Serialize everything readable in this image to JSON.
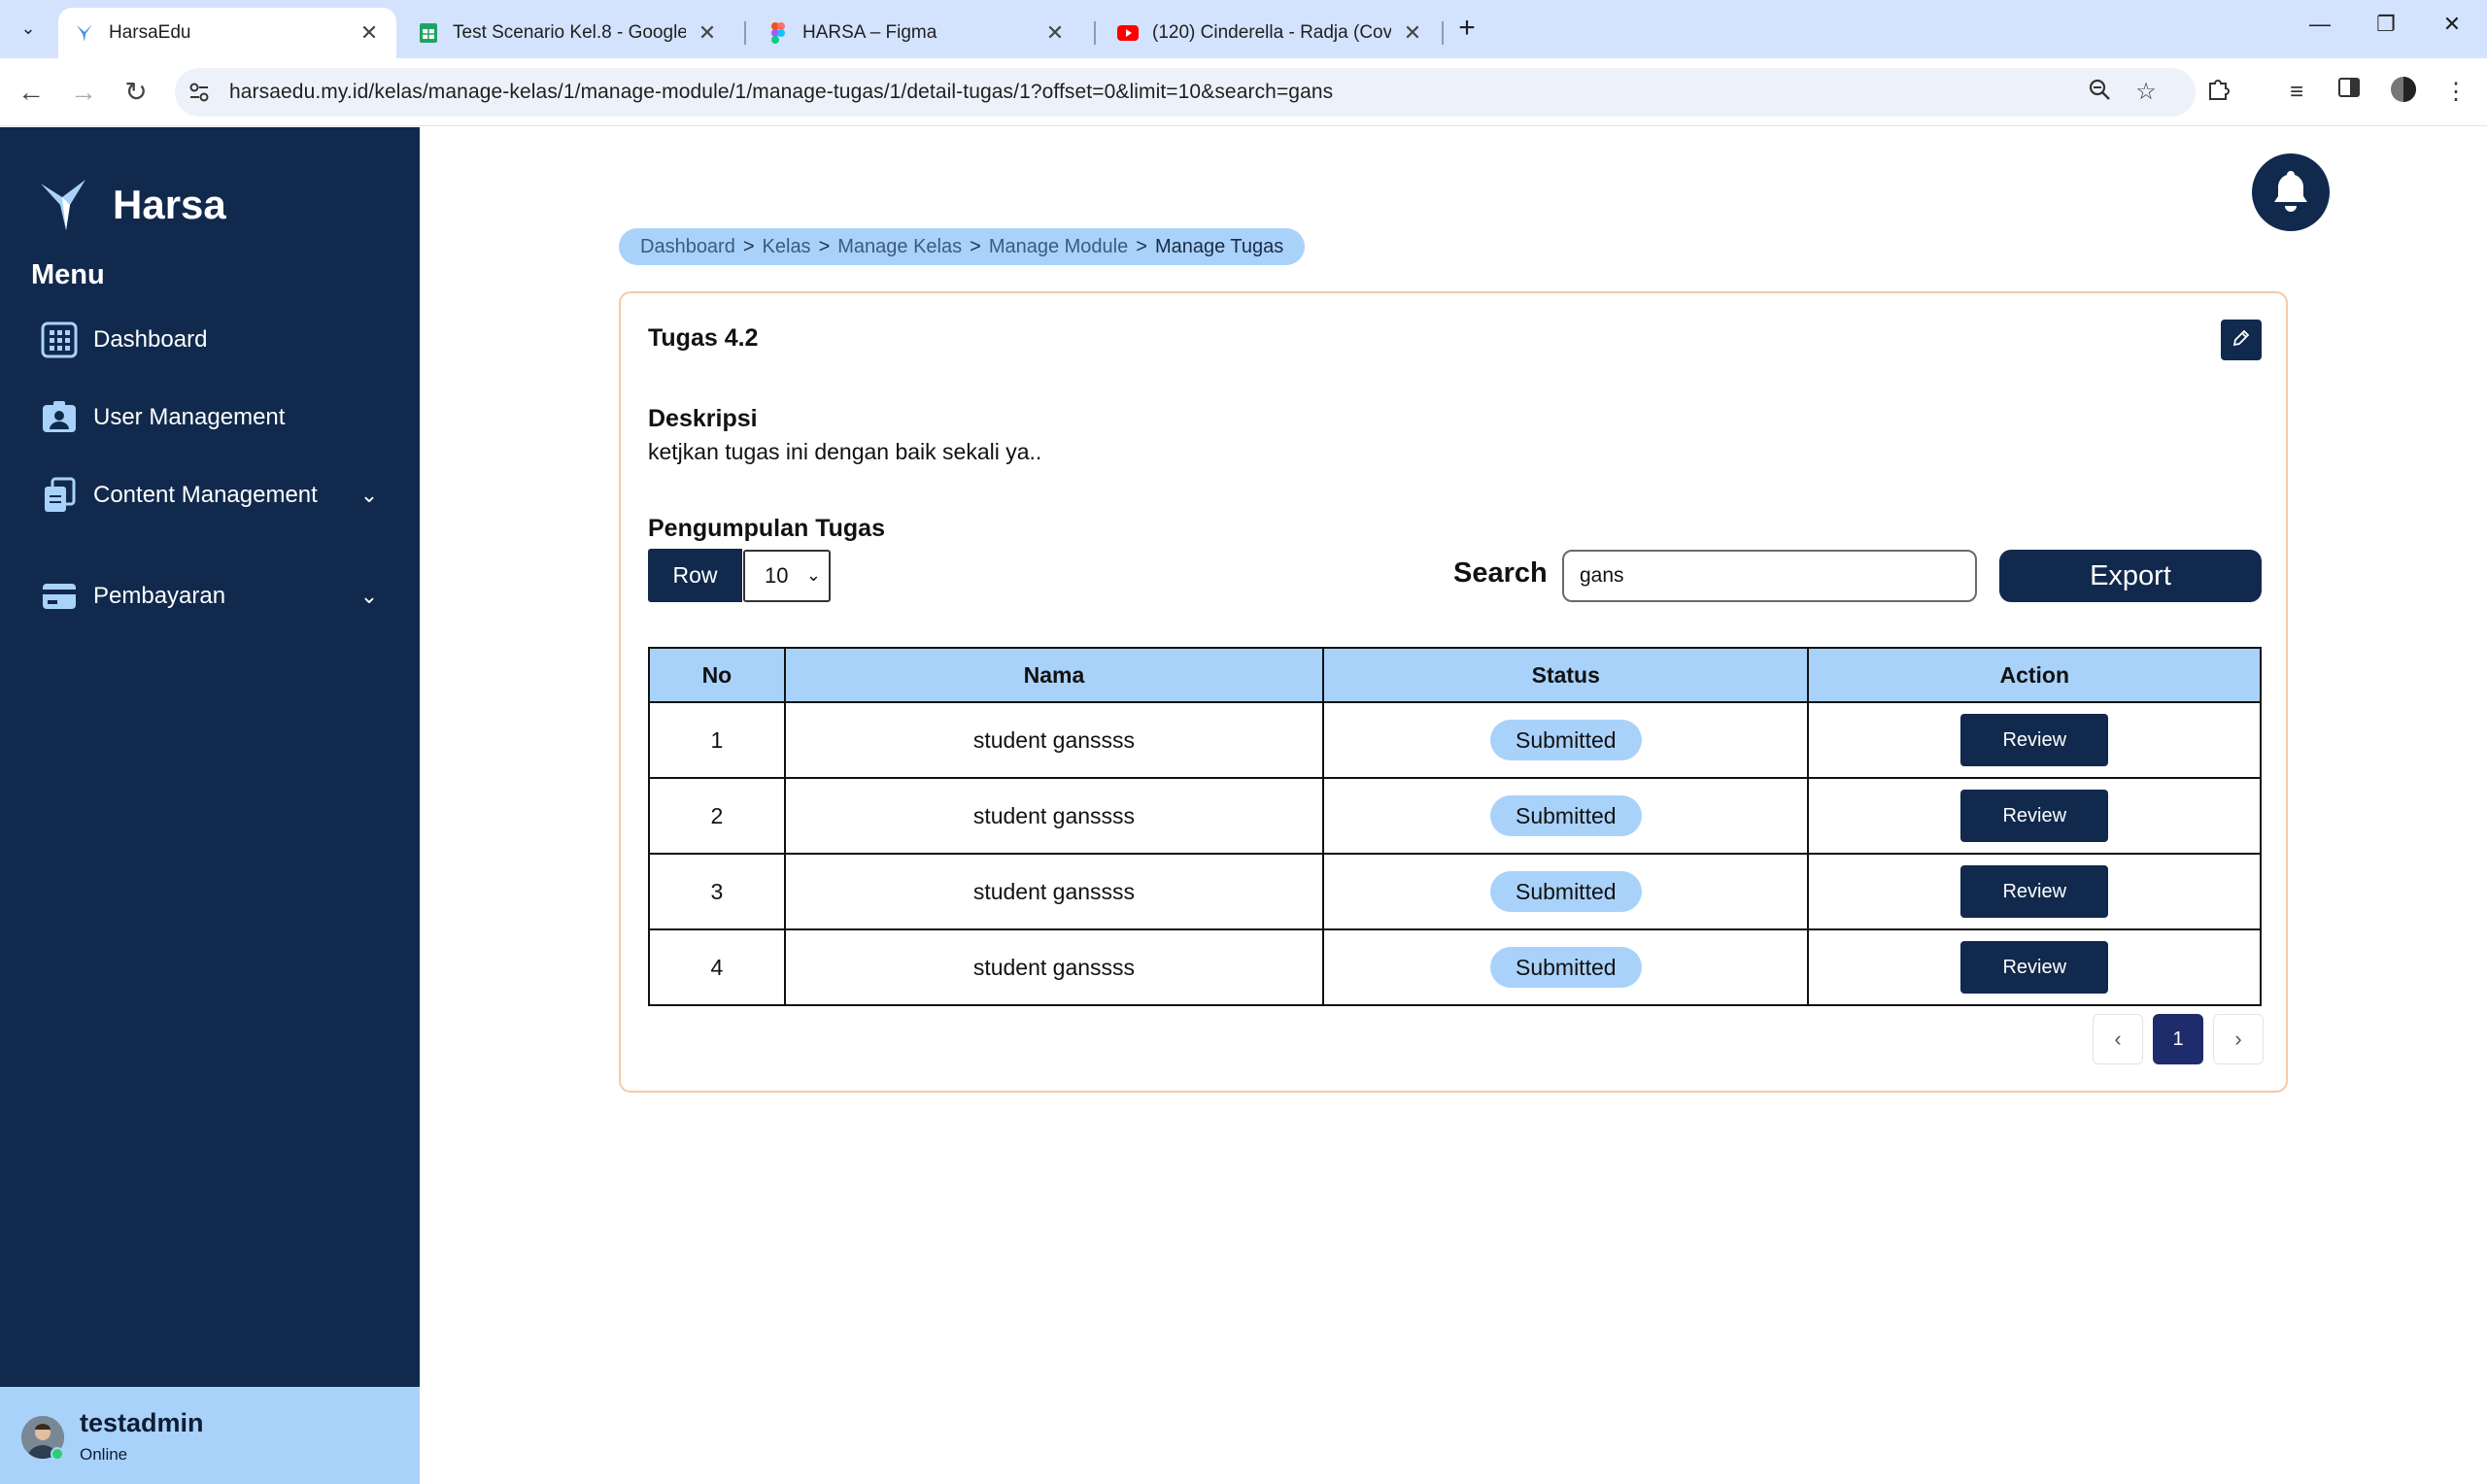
{
  "browser": {
    "tabs": [
      {
        "title": "HarsaEdu",
        "icon": "harsa-bird-icon",
        "active": true
      },
      {
        "title": "Test Scenario Kel.8 - Google Sp",
        "icon": "google-sheets-icon",
        "active": false
      },
      {
        "title": "HARSA – Figma",
        "icon": "figma-icon",
        "active": false
      },
      {
        "title": "(120) Cinderella - Radja (Cover",
        "icon": "youtube-icon",
        "active": false
      }
    ],
    "url": "harsaedu.my.id/kelas/manage-kelas/1/manage-module/1/manage-tugas/1/detail-tugas/1?offset=0&limit=10&search=gans",
    "colors": {
      "tabstrip": "#d3e3fd",
      "omnibox": "#edf2fa"
    }
  },
  "sidebar": {
    "brand": "Harsa",
    "menu_title": "Menu",
    "items": [
      {
        "label": "Dashboard",
        "icon": "grid-icon"
      },
      {
        "label": "User Management",
        "icon": "user-card-icon"
      },
      {
        "label": "Content Management",
        "icon": "documents-icon",
        "expandable": true
      },
      {
        "label": "Pembayaran",
        "icon": "payment-card-icon",
        "expandable": true
      }
    ],
    "user": {
      "name": "testadmin",
      "status": "Online"
    },
    "colors": {
      "background": "#11294d",
      "userbar": "#a9d2fb"
    }
  },
  "breadcrumb": {
    "items": [
      "Dashboard",
      "Kelas",
      "Manage Kelas",
      "Manage Module"
    ],
    "current": "Manage Tugas",
    "separator": ">"
  },
  "task": {
    "title": "Tugas 4.2",
    "description_label": "Deskripsi",
    "description": "ketjkan tugas ini dengan baik sekali ya..",
    "submissions_label": "Pengumpulan Tugas"
  },
  "controls": {
    "row_label": "Row",
    "row_value": "10",
    "search_label": "Search",
    "search_value": "gans",
    "export_label": "Export"
  },
  "table": {
    "headers": [
      "No",
      "Nama",
      "Status",
      "Action"
    ],
    "rows": [
      {
        "no": "1",
        "nama": "student ganssss",
        "status": "Submitted",
        "action": "Review"
      },
      {
        "no": "2",
        "nama": "student ganssss",
        "status": "Submitted",
        "action": "Review"
      },
      {
        "no": "3",
        "nama": "student ganssss",
        "status": "Submitted",
        "action": "Review"
      },
      {
        "no": "4",
        "nama": "student ganssss",
        "status": "Submitted",
        "action": "Review"
      }
    ]
  },
  "pagination": {
    "prev": "‹",
    "current": "1",
    "next": "›"
  },
  "colors": {
    "primary": "#11294d",
    "accent": "#a9d2fb",
    "card_border": "#f5c9a8",
    "pager_active": "#1f2c6b"
  }
}
